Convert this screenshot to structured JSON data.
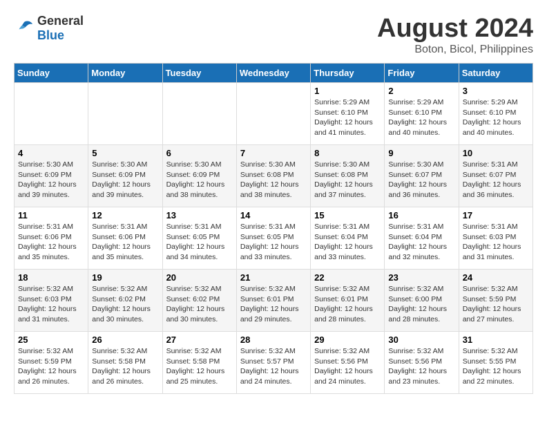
{
  "header": {
    "logo_line1": "General",
    "logo_line2": "Blue",
    "month_year": "August 2024",
    "location": "Boton, Bicol, Philippines"
  },
  "weekdays": [
    "Sunday",
    "Monday",
    "Tuesday",
    "Wednesday",
    "Thursday",
    "Friday",
    "Saturday"
  ],
  "weeks": [
    [
      {
        "day": "",
        "info": ""
      },
      {
        "day": "",
        "info": ""
      },
      {
        "day": "",
        "info": ""
      },
      {
        "day": "",
        "info": ""
      },
      {
        "day": "1",
        "info": "Sunrise: 5:29 AM\nSunset: 6:10 PM\nDaylight: 12 hours\nand 41 minutes."
      },
      {
        "day": "2",
        "info": "Sunrise: 5:29 AM\nSunset: 6:10 PM\nDaylight: 12 hours\nand 40 minutes."
      },
      {
        "day": "3",
        "info": "Sunrise: 5:29 AM\nSunset: 6:10 PM\nDaylight: 12 hours\nand 40 minutes."
      }
    ],
    [
      {
        "day": "4",
        "info": "Sunrise: 5:30 AM\nSunset: 6:09 PM\nDaylight: 12 hours\nand 39 minutes."
      },
      {
        "day": "5",
        "info": "Sunrise: 5:30 AM\nSunset: 6:09 PM\nDaylight: 12 hours\nand 39 minutes."
      },
      {
        "day": "6",
        "info": "Sunrise: 5:30 AM\nSunset: 6:09 PM\nDaylight: 12 hours\nand 38 minutes."
      },
      {
        "day": "7",
        "info": "Sunrise: 5:30 AM\nSunset: 6:08 PM\nDaylight: 12 hours\nand 38 minutes."
      },
      {
        "day": "8",
        "info": "Sunrise: 5:30 AM\nSunset: 6:08 PM\nDaylight: 12 hours\nand 37 minutes."
      },
      {
        "day": "9",
        "info": "Sunrise: 5:30 AM\nSunset: 6:07 PM\nDaylight: 12 hours\nand 36 minutes."
      },
      {
        "day": "10",
        "info": "Sunrise: 5:31 AM\nSunset: 6:07 PM\nDaylight: 12 hours\nand 36 minutes."
      }
    ],
    [
      {
        "day": "11",
        "info": "Sunrise: 5:31 AM\nSunset: 6:06 PM\nDaylight: 12 hours\nand 35 minutes."
      },
      {
        "day": "12",
        "info": "Sunrise: 5:31 AM\nSunset: 6:06 PM\nDaylight: 12 hours\nand 35 minutes."
      },
      {
        "day": "13",
        "info": "Sunrise: 5:31 AM\nSunset: 6:05 PM\nDaylight: 12 hours\nand 34 minutes."
      },
      {
        "day": "14",
        "info": "Sunrise: 5:31 AM\nSunset: 6:05 PM\nDaylight: 12 hours\nand 33 minutes."
      },
      {
        "day": "15",
        "info": "Sunrise: 5:31 AM\nSunset: 6:04 PM\nDaylight: 12 hours\nand 33 minutes."
      },
      {
        "day": "16",
        "info": "Sunrise: 5:31 AM\nSunset: 6:04 PM\nDaylight: 12 hours\nand 32 minutes."
      },
      {
        "day": "17",
        "info": "Sunrise: 5:31 AM\nSunset: 6:03 PM\nDaylight: 12 hours\nand 31 minutes."
      }
    ],
    [
      {
        "day": "18",
        "info": "Sunrise: 5:32 AM\nSunset: 6:03 PM\nDaylight: 12 hours\nand 31 minutes."
      },
      {
        "day": "19",
        "info": "Sunrise: 5:32 AM\nSunset: 6:02 PM\nDaylight: 12 hours\nand 30 minutes."
      },
      {
        "day": "20",
        "info": "Sunrise: 5:32 AM\nSunset: 6:02 PM\nDaylight: 12 hours\nand 30 minutes."
      },
      {
        "day": "21",
        "info": "Sunrise: 5:32 AM\nSunset: 6:01 PM\nDaylight: 12 hours\nand 29 minutes."
      },
      {
        "day": "22",
        "info": "Sunrise: 5:32 AM\nSunset: 6:01 PM\nDaylight: 12 hours\nand 28 minutes."
      },
      {
        "day": "23",
        "info": "Sunrise: 5:32 AM\nSunset: 6:00 PM\nDaylight: 12 hours\nand 28 minutes."
      },
      {
        "day": "24",
        "info": "Sunrise: 5:32 AM\nSunset: 5:59 PM\nDaylight: 12 hours\nand 27 minutes."
      }
    ],
    [
      {
        "day": "25",
        "info": "Sunrise: 5:32 AM\nSunset: 5:59 PM\nDaylight: 12 hours\nand 26 minutes."
      },
      {
        "day": "26",
        "info": "Sunrise: 5:32 AM\nSunset: 5:58 PM\nDaylight: 12 hours\nand 26 minutes."
      },
      {
        "day": "27",
        "info": "Sunrise: 5:32 AM\nSunset: 5:58 PM\nDaylight: 12 hours\nand 25 minutes."
      },
      {
        "day": "28",
        "info": "Sunrise: 5:32 AM\nSunset: 5:57 PM\nDaylight: 12 hours\nand 24 minutes."
      },
      {
        "day": "29",
        "info": "Sunrise: 5:32 AM\nSunset: 5:56 PM\nDaylight: 12 hours\nand 24 minutes."
      },
      {
        "day": "30",
        "info": "Sunrise: 5:32 AM\nSunset: 5:56 PM\nDaylight: 12 hours\nand 23 minutes."
      },
      {
        "day": "31",
        "info": "Sunrise: 5:32 AM\nSunset: 5:55 PM\nDaylight: 12 hours\nand 22 minutes."
      }
    ]
  ]
}
